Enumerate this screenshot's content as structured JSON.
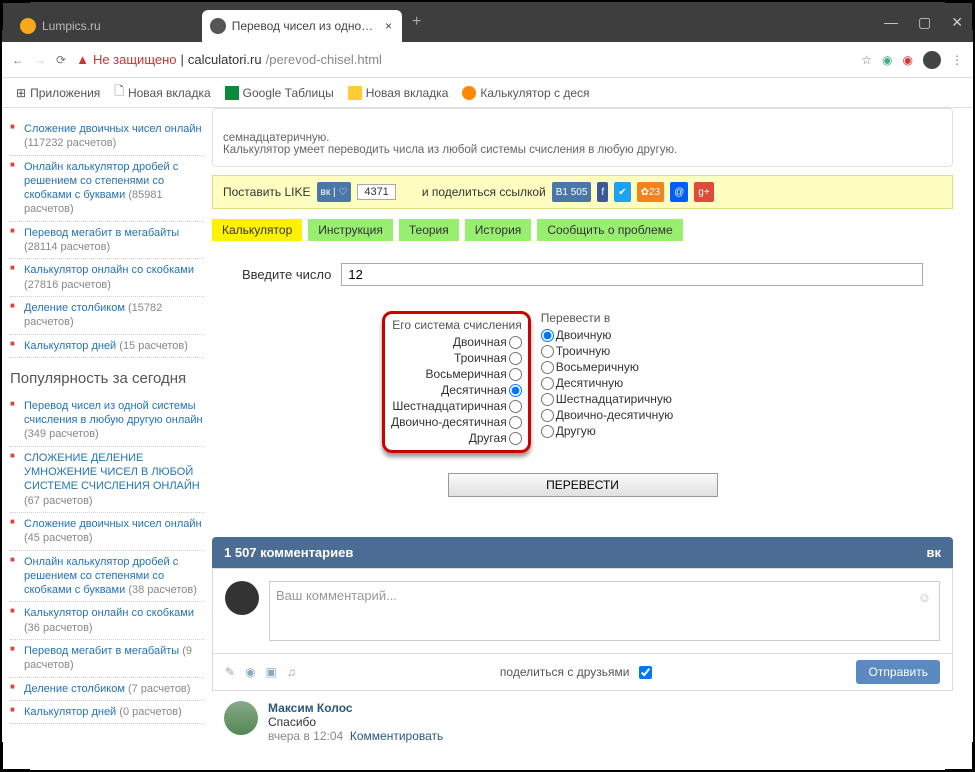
{
  "browser": {
    "tabs": [
      {
        "title": "Lumpics.ru"
      },
      {
        "title": "Перевод чисел из одной систе..."
      }
    ],
    "addrbar": {
      "warn": "Не защищено",
      "url_host": "calculatori.ru",
      "url_path": "/perevod-chisel.html"
    },
    "bookmarks": [
      {
        "label": "Приложения"
      },
      {
        "label": "Новая вкладка"
      },
      {
        "label": "Google Таблицы"
      },
      {
        "label": "Новая вкладка"
      },
      {
        "label": "Калькулятор с деся"
      }
    ]
  },
  "sidebar": {
    "top": [
      {
        "t": "Сложение двоичных чисел онлайн",
        "c": "(117232 расчетов)"
      },
      {
        "t": "Онлайн калькулятор дробей с решением со степенями со скобками с буквами",
        "c": "(85981 расчетов)"
      },
      {
        "t": "Перевод мегабит в мегабайты",
        "c": "(28114 расчетов)"
      },
      {
        "t": "Калькулятор онлайн со скобками",
        "c": "(27816 расчетов)"
      },
      {
        "t": "Деление столбиком",
        "c": "(15782 расчетов)"
      },
      {
        "t": "Калькулятор дней",
        "c": "(15 расчетов)"
      }
    ],
    "header": "Популярность за сегодня",
    "today": [
      {
        "t": "Перевод чисел из одной системы счисления в любую другую онлайн",
        "c": "(349 расчетов)"
      },
      {
        "t": "СЛОЖЕНИЕ ДЕЛЕНИЕ УМНОЖЕНИЕ ЧИСЕЛ В ЛЮБОЙ СИСТЕМЕ СЧИСЛЕНИЯ ОНЛАЙН",
        "c": "(67 расчетов)"
      },
      {
        "t": "Сложение двоичных чисел онлайн",
        "c": "(45 расчетов)"
      },
      {
        "t": "Онлайн калькулятор дробей с решением со степенями со скобками с буквами",
        "c": "(38 расчетов)"
      },
      {
        "t": "Калькулятор онлайн со скобками",
        "c": "(36 расчетов)"
      },
      {
        "t": "Перевод мегабит в мегабайты",
        "c": "(9 расчетов)"
      },
      {
        "t": "Деление столбиком",
        "c": "(7 расчетов)"
      },
      {
        "t": "Калькулятор дней",
        "c": "(0 расчетов)"
      }
    ]
  },
  "main": {
    "desc_l1": "семнадцатеричную.",
    "desc_l2": "Калькулятор умеет переводить числа из любой системы счисления в любую другую.",
    "like_label": "Поставить LIKE",
    "like_count": "4371",
    "share_label": "и поделиться ссылкой",
    "vk_count": "1 505",
    "ok_count": "23",
    "tabs": [
      "Калькулятор",
      "Инструкция",
      "Теория",
      "История",
      "Сообщить о проблеме"
    ],
    "input_label": "Введите число",
    "input_value": "12",
    "from_header": "Его система счисления",
    "from": [
      "Двоичная",
      "Троичная",
      "Восьмеричная",
      "Десятичная",
      "Шестнадцатиричная",
      "Двоично-десятичная",
      "Другая"
    ],
    "to_header": "Перевести в",
    "to": [
      "Двоичную",
      "Троичную",
      "Восьмеричную",
      "Десятичную",
      "Шестнадцатиричную",
      "Двоично-десятичную",
      "Другую"
    ],
    "from_selected": 3,
    "to_selected": 0,
    "convert": "ПЕРЕВЕСТИ"
  },
  "comments": {
    "header": "1 507 комментариев",
    "placeholder": "Ваш комментарий...",
    "share": "поделиться с друзьями",
    "send": "Отправить",
    "item": {
      "name": "Максим Колос",
      "text": "Спасибо",
      "time": "вчера в 12:04",
      "reply": "Комментировать"
    }
  }
}
